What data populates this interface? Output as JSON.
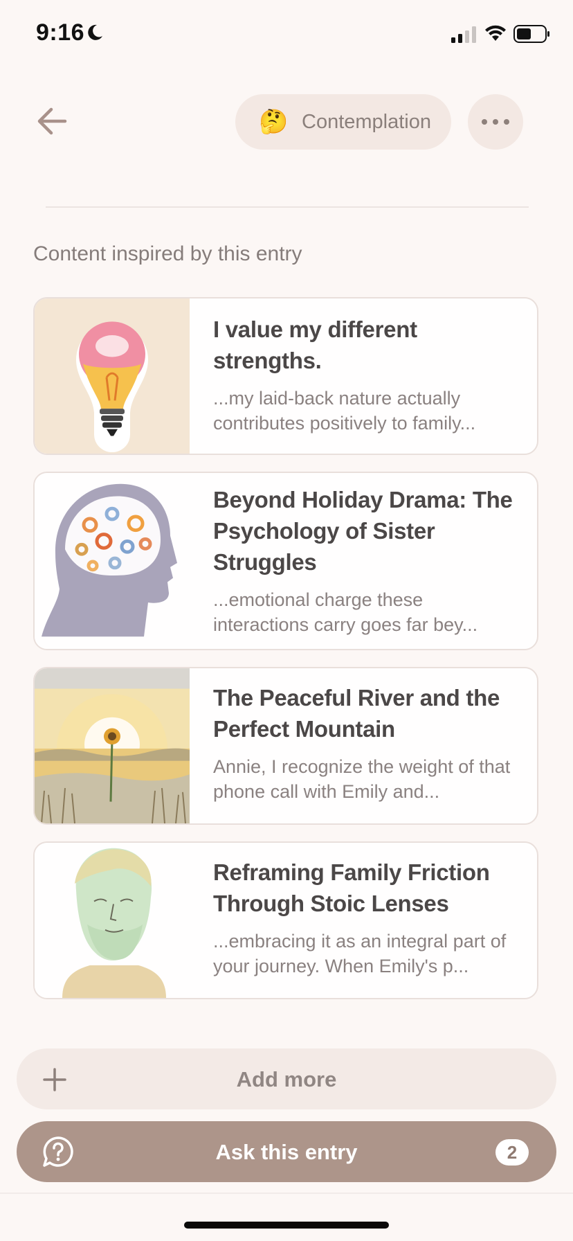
{
  "status_bar": {
    "time": "9:16"
  },
  "header": {
    "mood_emoji": "🤔",
    "mood_label": "Contemplation"
  },
  "section_title": "Content inspired by this entry",
  "cards": [
    {
      "title": "I value my different strengths.",
      "snippet": "...my laid-back nature actually contributes positively to family...",
      "thumbnail": "lightbulb-illustration"
    },
    {
      "title": "Beyond Holiday Drama: The Psychology of Sister Struggles",
      "snippet": "...emotional charge these interactions carry goes far bey...",
      "thumbnail": "head-with-gears-illustration"
    },
    {
      "title": "The Peaceful River and the Perfect Mountain",
      "snippet": "Annie, I recognize the weight of that phone call with Emily and...",
      "thumbnail": "sunflower-sunset-illustration"
    },
    {
      "title": "Reframing Family Friction Through Stoic Lenses",
      "snippet": "...embracing it as an integral part of your journey. When Emily's p...",
      "thumbnail": "stoic-bust-illustration"
    }
  ],
  "actions": {
    "add_more_label": "Add more",
    "ask_label": "Ask this entry",
    "ask_badge": "2"
  },
  "colors": {
    "background": "#fcf7f5",
    "pill": "#f3e8e3",
    "ask_button": "#ad958a"
  }
}
